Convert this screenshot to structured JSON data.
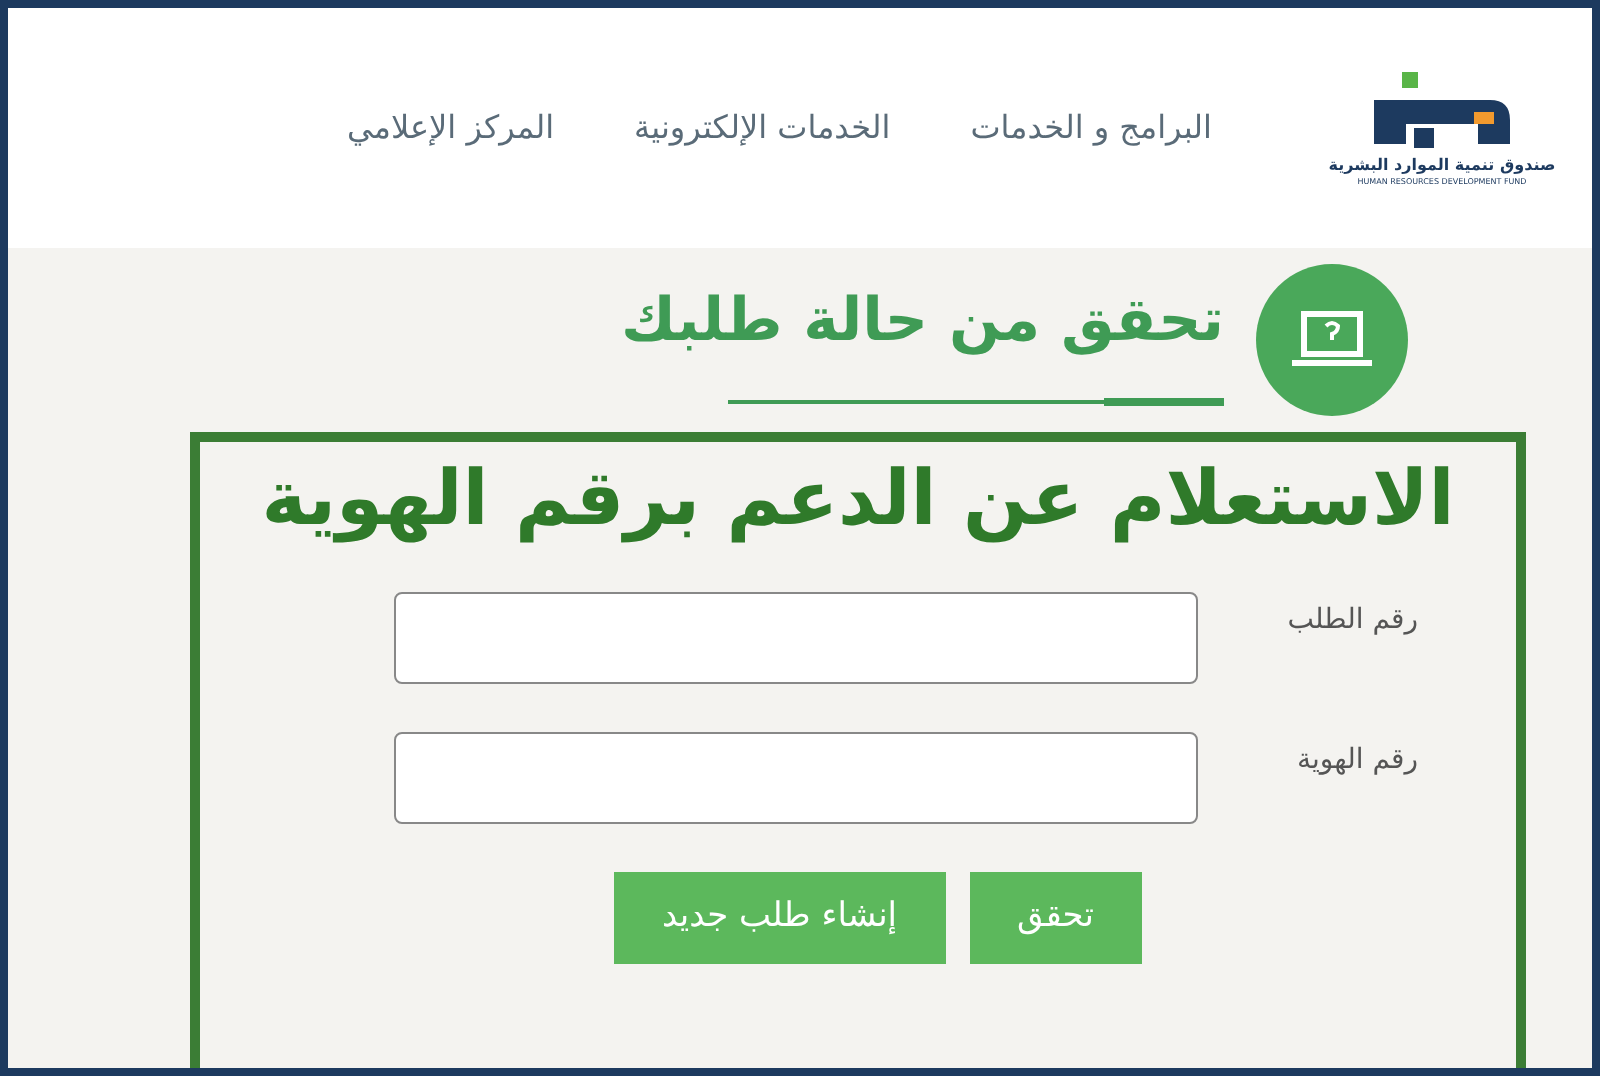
{
  "header": {
    "logo": {
      "name_ar": "صندوق تنمية الموارد البشرية",
      "name_en": "HUMAN RESOURCES DEVELOPMENT FUND"
    },
    "nav": [
      {
        "label": "البرامج و الخدمات"
      },
      {
        "label": "الخدمات الإلكترونية"
      },
      {
        "label": "المركز الإعلامي"
      }
    ]
  },
  "section": {
    "title": "تحقق من حالة طلبك"
  },
  "form": {
    "heading": "الاستعلام عن الدعم برقم الهوية",
    "fields": [
      {
        "label": "رقم الطلب"
      },
      {
        "label": "رقم الهوية"
      }
    ],
    "buttons": [
      {
        "label": "تحقق"
      },
      {
        "label": "إنشاء طلب جديد"
      }
    ]
  }
}
